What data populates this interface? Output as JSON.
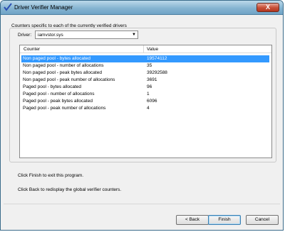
{
  "window": {
    "title": "Driver Verifier Manager",
    "close_label": "X"
  },
  "group": {
    "label": "Counters specific to each of the currently verified drivers"
  },
  "driver": {
    "label": "Driver:",
    "selected": "iamvstor.sys"
  },
  "list": {
    "columns": [
      "Counter",
      "Value"
    ],
    "rows": [
      {
        "counter": "Non paged pool - bytes allocated",
        "value": "19574112",
        "selected": true
      },
      {
        "counter": "Non paged pool - number of allocations",
        "value": "35"
      },
      {
        "counter": "Non paged pool - peak bytes allocated",
        "value": "39292588"
      },
      {
        "counter": "Non paged pool - peak number of allocations",
        "value": "3691"
      },
      {
        "counter": "Paged pool - bytes allocated",
        "value": "96"
      },
      {
        "counter": "Paged pool - number of allocations",
        "value": "1"
      },
      {
        "counter": "Paged pool - peak bytes allocated",
        "value": "6096"
      },
      {
        "counter": "Paged pool - peak number of allocations",
        "value": "4"
      }
    ]
  },
  "messages": {
    "finish": "Click Finish to exit this program.",
    "back": "Click Back to redisplay the global verifier counters."
  },
  "buttons": {
    "back": "< Back",
    "finish": "Finish",
    "cancel": "Cancel"
  }
}
